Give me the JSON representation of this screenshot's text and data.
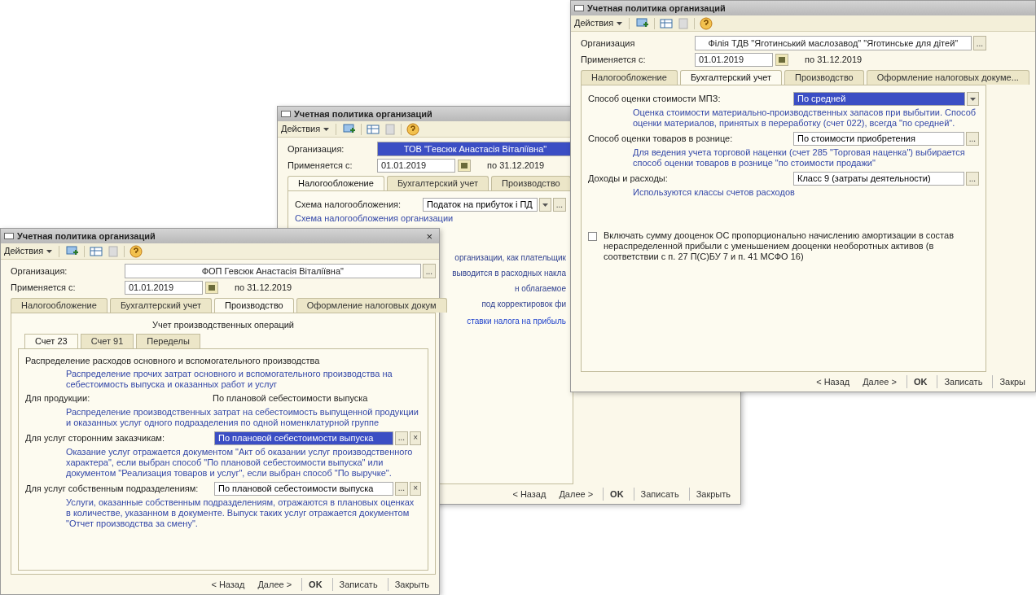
{
  "windows": [
    {
      "title": "Учетная политика организаций",
      "actions": "Действия",
      "organization": {
        "label": "Организация",
        "value": "Філія ТДВ \"Яготинський маслозавод\" \"Яготинське для дітей\"",
        "highlighted": false,
        "button": "..."
      },
      "period": {
        "label": "Применяется с:",
        "from": "01.01.2019",
        "to": "по 31.12.2019"
      },
      "tabs": [
        {
          "label": "Налогообложение",
          "selected": false
        },
        {
          "label": "Бухгалтерский учет",
          "selected": true
        },
        {
          "label": "Производство",
          "selected": false
        },
        {
          "label": "Оформление налоговых докуме...",
          "selected": false
        }
      ],
      "rows": [
        {
          "kind": "field",
          "label": "Способ оценки стоимости МПЗ:",
          "value": "По средней",
          "highlighted": true,
          "dropdown": true,
          "buttons": []
        },
        {
          "kind": "note",
          "text": "Оценка стоимости материально-производственных запасов при выбытии. Способ оценки материалов, принятых в переработку (счет 022), всегда \"по средней\"."
        },
        {
          "kind": "field",
          "label": "Способ оценки товаров в рознице:",
          "value": "По стоимости приобретения",
          "highlighted": false,
          "dropdown": false,
          "buttons": [
            "..."
          ]
        },
        {
          "kind": "note",
          "text": "Для ведения учета торговой наценки (счет 285 \"Торговая наценка\") выбирается способ оценки товаров в рознице \"по стоимости продажи\""
        },
        {
          "kind": "field",
          "label": "Доходы и расходы:",
          "value": "Класс 9 (затраты деятельности)",
          "highlighted": false,
          "dropdown": false,
          "buttons": [
            "..."
          ]
        },
        {
          "kind": "note",
          "text": "Используются классы счетов расходов"
        },
        {
          "kind": "checkbox",
          "checked": false,
          "text": "Включать сумму дооценок ОС пропорционально начислению амортизации в состав нераспределенной прибыли с уменьшением дооценки необоротных активов (в соответствии с п. 27 П(С)БУ 7 и п. 41 МСФО 16)"
        }
      ],
      "footer": [
        "< Назад",
        "Далее >",
        "OK",
        "Записать",
        "Закры"
      ]
    },
    {
      "title": "Учетная политика организаций",
      "actions": "Действия",
      "organization": {
        "label": "Организация:",
        "value": "ТОВ \"Гевсюк Анастасія Віталіївна\"",
        "highlighted": true
      },
      "period": {
        "label": "Применяется с:",
        "from": "01.01.2019",
        "to": "по 31.12.2019"
      },
      "tabs": [
        {
          "label": "Налогообложение",
          "selected": true
        },
        {
          "label": "Бухгалтерский учет",
          "selected": false
        },
        {
          "label": "Производство",
          "selected": false
        }
      ],
      "rows": [
        {
          "kind": "field",
          "label": "Схема налогообложения:",
          "value": "Податок на прибуток і ПД",
          "highlighted": false,
          "dropdown": true,
          "buttons": [
            "..."
          ]
        },
        {
          "kind": "note",
          "text": "Схема налогообложения организации"
        },
        {
          "kind": "fragment",
          "text": "организации, как плательщик"
        },
        {
          "kind": "fragment",
          "text": "выводится в расходных накла"
        },
        {
          "kind": "fragment",
          "text": "н облагаемое"
        },
        {
          "kind": "fragment",
          "text": "под корректировок фи"
        },
        {
          "kind": "link",
          "text": "ставки налога на прибыль"
        }
      ],
      "footer": [
        "< Назад",
        "Далее >",
        "OK",
        "Записать",
        "Закрыть"
      ]
    },
    {
      "title": "Учетная политика организаций",
      "close": "×",
      "actions": "Действия",
      "organization": {
        "label": "Организация:",
        "value": "ФОП Гевсюк Анастасія Віталіївна\"",
        "highlighted": false,
        "button": "..."
      },
      "period": {
        "label": "Применяется с:",
        "from": "01.01.2019",
        "to": "по 31.12.2019"
      },
      "tabs": [
        {
          "label": "Налогообложение",
          "selected": false
        },
        {
          "label": "Бухгалтерский учет",
          "selected": false
        },
        {
          "label": "Производство",
          "selected": true
        },
        {
          "label": "Оформление налоговых докум",
          "selected": false
        }
      ],
      "rows": [
        {
          "kind": "heading",
          "text": "Учет производственных операций"
        },
        {
          "kind": "subtabs",
          "items": [
            {
              "label": "Счет 23",
              "selected": true
            },
            {
              "label": "Счет 91",
              "selected": false
            },
            {
              "label": "Переделы",
              "selected": false
            }
          ],
          "rows": [
            {
              "kind": "section",
              "text": "Распределение расходов основного и вспомогательного производства"
            },
            {
              "kind": "note",
              "text": "Распределение прочих затрат основного и вспомогательного производства на себестоимость выпуска и оказанных работ и услуг"
            },
            {
              "kind": "pair",
              "label": "Для продукции:",
              "value": "По плановой себестоимости выпуска"
            },
            {
              "kind": "note",
              "text": "Распределение производственных затрат на себестоимость выпущенной продукции и оказанных услуг одного подразделения по одной номенклатурной группе"
            },
            {
              "kind": "field",
              "label": "Для услуг сторонним заказчикам:",
              "value": "По плановой себестоимости выпуска",
              "highlighted": true,
              "dropdown": false,
              "buttons": [
                "...",
                "×"
              ]
            },
            {
              "kind": "note",
              "text": "Оказание услуг отражается документом \"Акт об оказании услуг производственного характера\", если выбран способ \"По плановой себестоимости выпуска\" или документом \"Реализация товаров и услуг\", если выбран способ \"По выручке\"."
            },
            {
              "kind": "field",
              "label": "Для услуг собственным подразделениям:",
              "value": "По плановой себестоимости выпуска",
              "highlighted": false,
              "dropdown": false,
              "buttons": [
                "...",
                "×"
              ]
            },
            {
              "kind": "note",
              "text": "Услуги, оказанные собственным подразделениям, отражаются в плановых оценках в количестве, указанном в документе. Выпуск таких услуг отражается документом \"Отчет производства за смену\"."
            }
          ]
        }
      ],
      "footer": [
        "< Назад",
        "Далее >",
        "OK",
        "Записать",
        "Закрыть"
      ]
    }
  ]
}
